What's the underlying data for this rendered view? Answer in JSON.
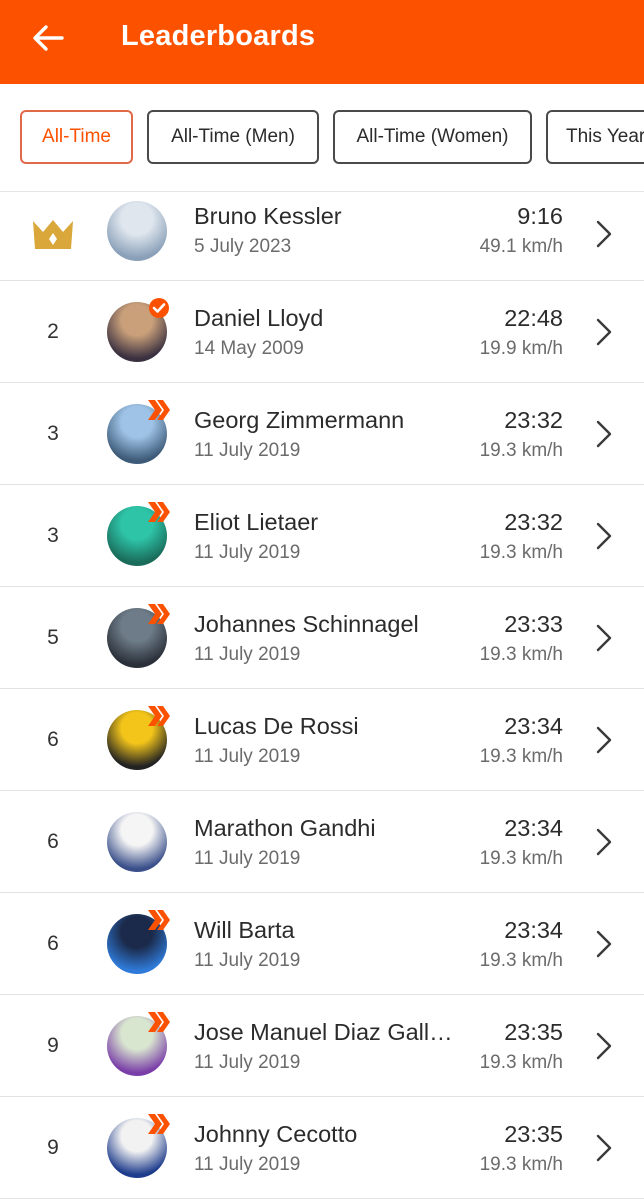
{
  "appbar": {
    "title": "Leaderboards",
    "back_icon": "arrow-left-icon",
    "color": "#fc5200"
  },
  "filters": [
    {
      "label": "All-Time",
      "active": true
    },
    {
      "label": "All-Time (Men)",
      "active": false
    },
    {
      "label": "All-Time (Women)",
      "active": false
    },
    {
      "label": "This Year",
      "active": false
    }
  ],
  "leaderboard": [
    {
      "rank": "",
      "rank_icon": "crown-icon",
      "name": "Bruno Kessler",
      "date": "5 July 2023",
      "time": "9:16",
      "speed": "49.1 km/h",
      "badge": "none",
      "avatar_colors": [
        "#dfe6ee",
        "#8aa0b8"
      ]
    },
    {
      "rank": "2",
      "name": "Daniel Lloyd",
      "date": "14 May 2009",
      "time": "22:48",
      "speed": "19.9 km/h",
      "badge": "verified-check-icon",
      "avatar_colors": [
        "#c9a07a",
        "#3a3040"
      ]
    },
    {
      "rank": "3",
      "name": "Georg Zimmermann",
      "date": "11 July 2019",
      "time": "23:32",
      "speed": "19.3 km/h",
      "badge": "subscriber-chevron-icon",
      "avatar_colors": [
        "#9ec3e6",
        "#3d5a78"
      ]
    },
    {
      "rank": "3",
      "name": "Eliot Lietaer",
      "date": "11 July 2019",
      "time": "23:32",
      "speed": "19.3 km/h",
      "badge": "subscriber-chevron-icon",
      "avatar_colors": [
        "#2ec4a8",
        "#1a6b5a"
      ]
    },
    {
      "rank": "5",
      "name": "Johannes Schinnagel",
      "date": "11 July 2019",
      "time": "23:33",
      "speed": "19.3 km/h",
      "badge": "subscriber-chevron-icon",
      "avatar_colors": [
        "#6d7c88",
        "#2a2f38"
      ]
    },
    {
      "rank": "6",
      "name": "Lucas De Rossi",
      "date": "11 July 2019",
      "time": "23:34",
      "speed": "19.3 km/h",
      "badge": "subscriber-chevron-icon",
      "avatar_colors": [
        "#f3c51a",
        "#222222"
      ]
    },
    {
      "rank": "6",
      "name": "Marathon  Gandhi",
      "date": "11 July 2019",
      "time": "23:34",
      "speed": "19.3 km/h",
      "badge": "none",
      "avatar_colors": [
        "#f5f5f5",
        "#3a4f8a"
      ]
    },
    {
      "rank": "6",
      "name": "Will Barta",
      "date": "11 July 2019",
      "time": "23:34",
      "speed": "19.3 km/h",
      "badge": "subscriber-chevron-icon",
      "avatar_colors": [
        "#1b2a4a",
        "#2f7ad8"
      ]
    },
    {
      "rank": "9",
      "name": "Jose Manuel Diaz Gallego",
      "date": "11 July 2019",
      "time": "23:35",
      "speed": "19.3 km/h",
      "badge": "subscriber-chevron-icon",
      "avatar_colors": [
        "#d9e6cf",
        "#7a3ea8"
      ]
    },
    {
      "rank": "9",
      "name": "Johnny Cecotto",
      "date": "11 July 2019",
      "time": "23:35",
      "speed": "19.3 km/h",
      "badge": "subscriber-chevron-icon",
      "avatar_colors": [
        "#f2f2f2",
        "#1e3c8c"
      ]
    }
  ],
  "colors": {
    "accent": "#fc5200",
    "crown": "#d9a73a",
    "active_chip_border": "#e06a48"
  }
}
